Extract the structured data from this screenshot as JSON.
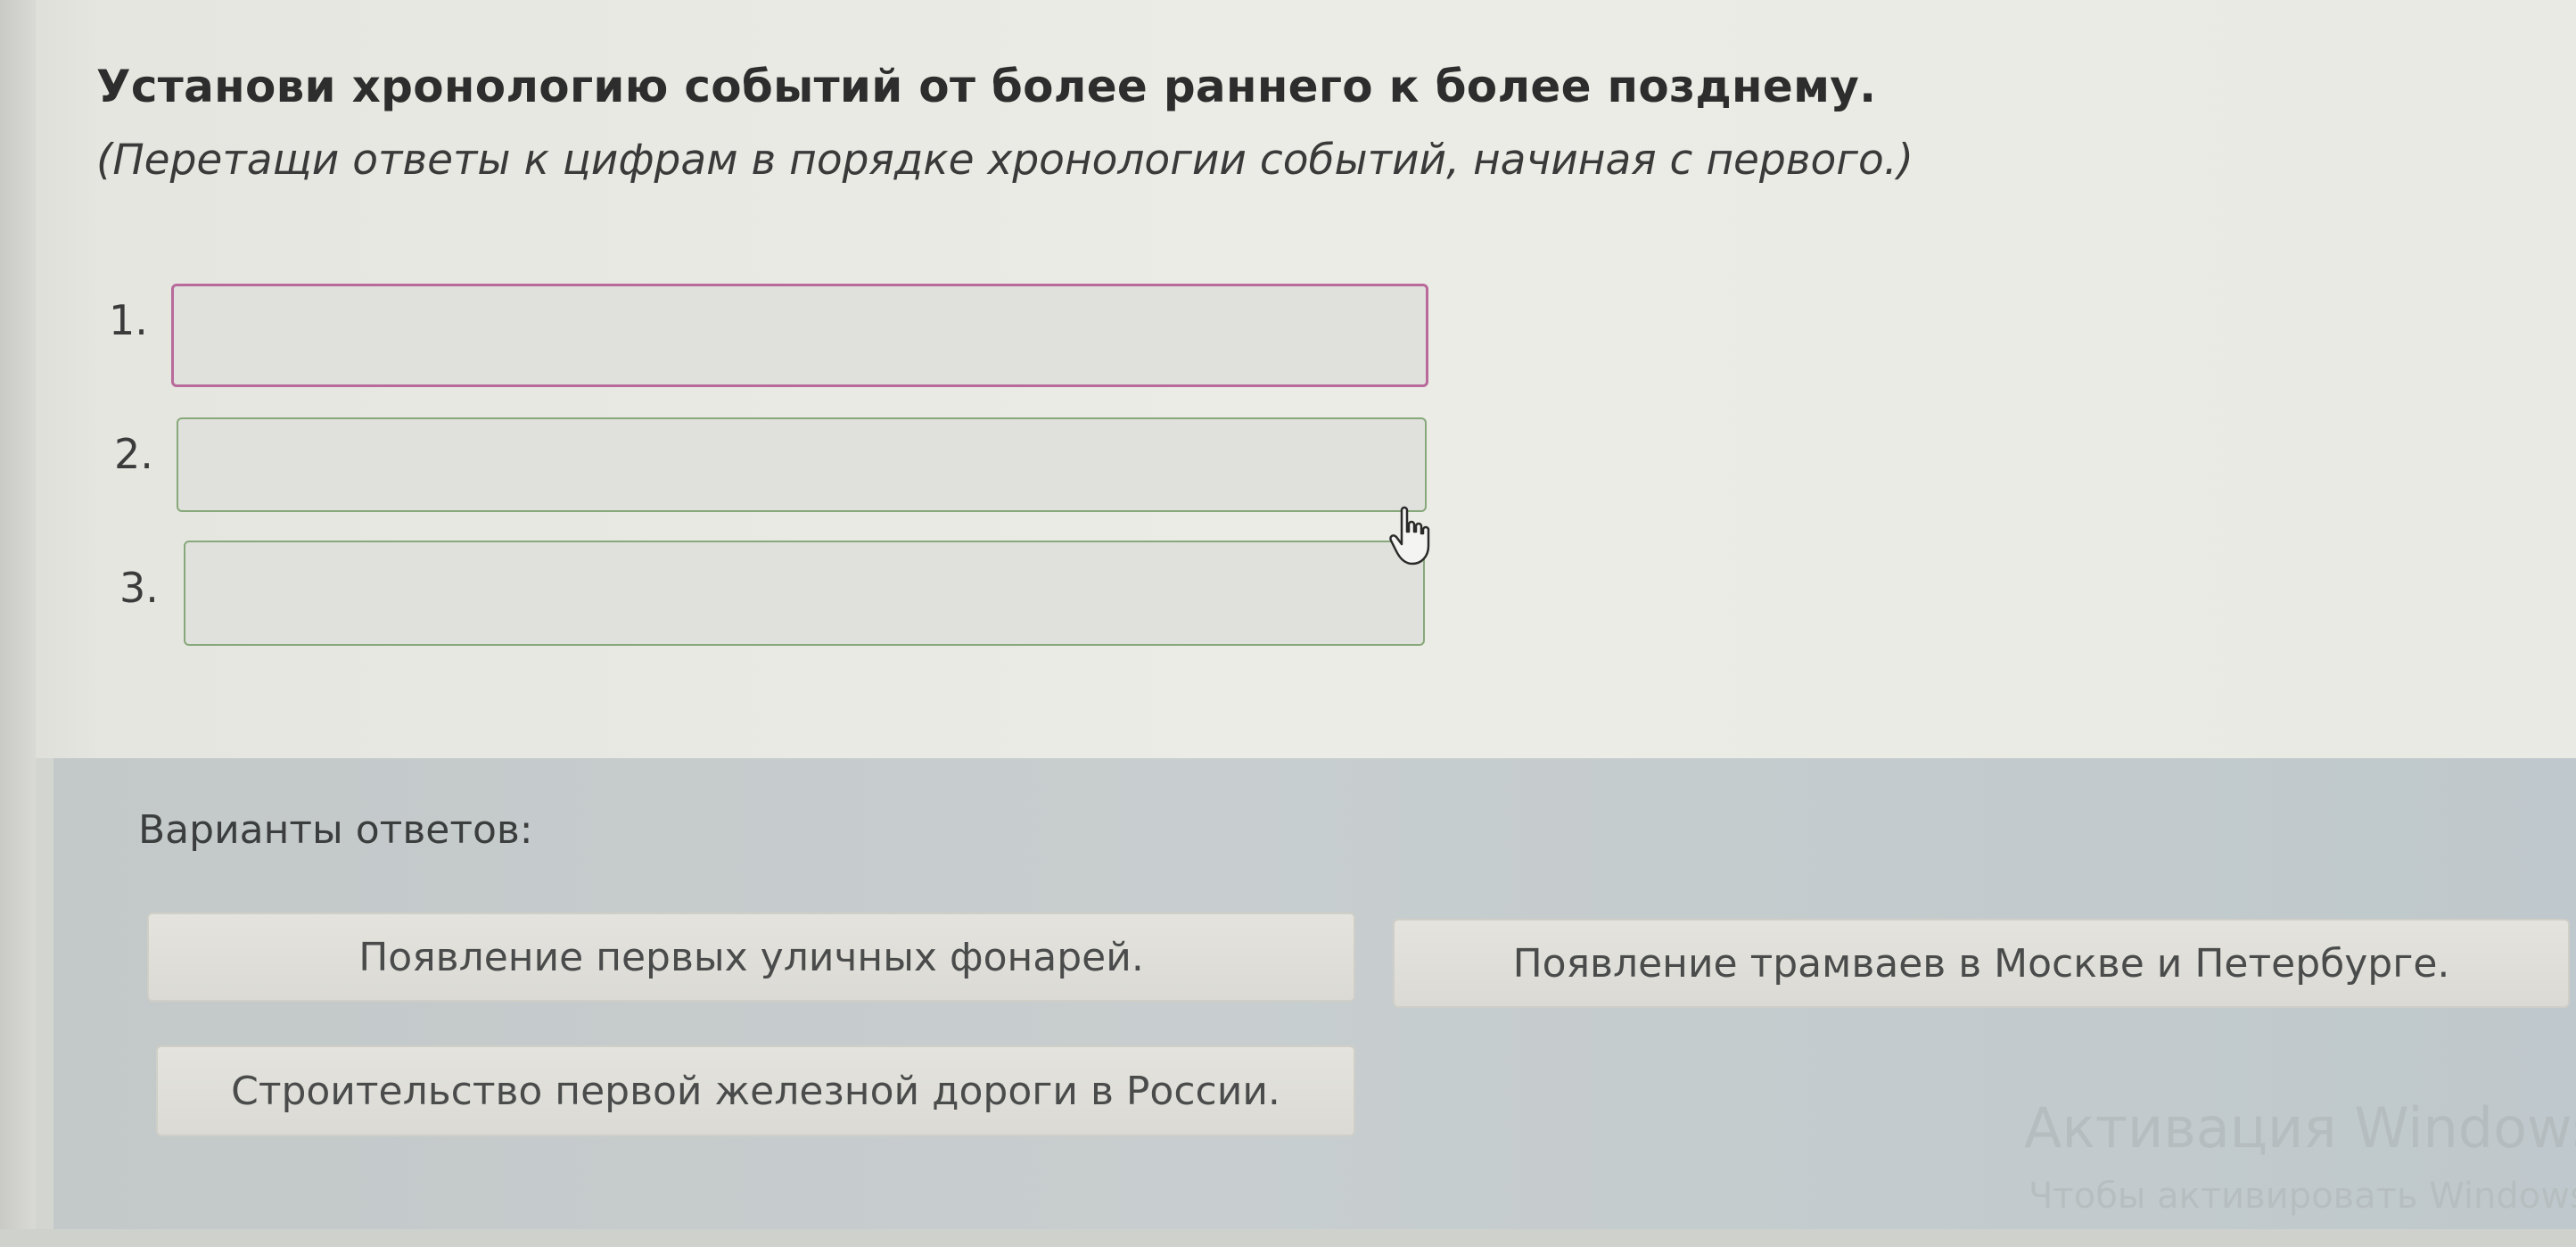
{
  "question": {
    "title": "Установи хронологию событий от более раннего к более позднему.",
    "hint": "(Перетащи ответы к цифрам в порядке хронологии событий, начиная с первого.)"
  },
  "slots": [
    {
      "number": "1.",
      "value": ""
    },
    {
      "number": "2.",
      "value": ""
    },
    {
      "number": "3.",
      "value": ""
    }
  ],
  "answers": {
    "label": "Варианты ответов:",
    "options": [
      "Появление первых уличных фонарей.",
      "Появление трамваев в Москве и Петербурге.",
      "Строительство первой железной дороги в России."
    ]
  },
  "watermark": {
    "line1": "Активация Windows",
    "line2": "Чтобы активировать Windows"
  },
  "colors": {
    "active_slot_border": "#b86a9a",
    "slot_border": "#86a87a",
    "answers_background": "#c6cccd"
  },
  "icons": {
    "cursor": "hand-pointer-icon"
  }
}
